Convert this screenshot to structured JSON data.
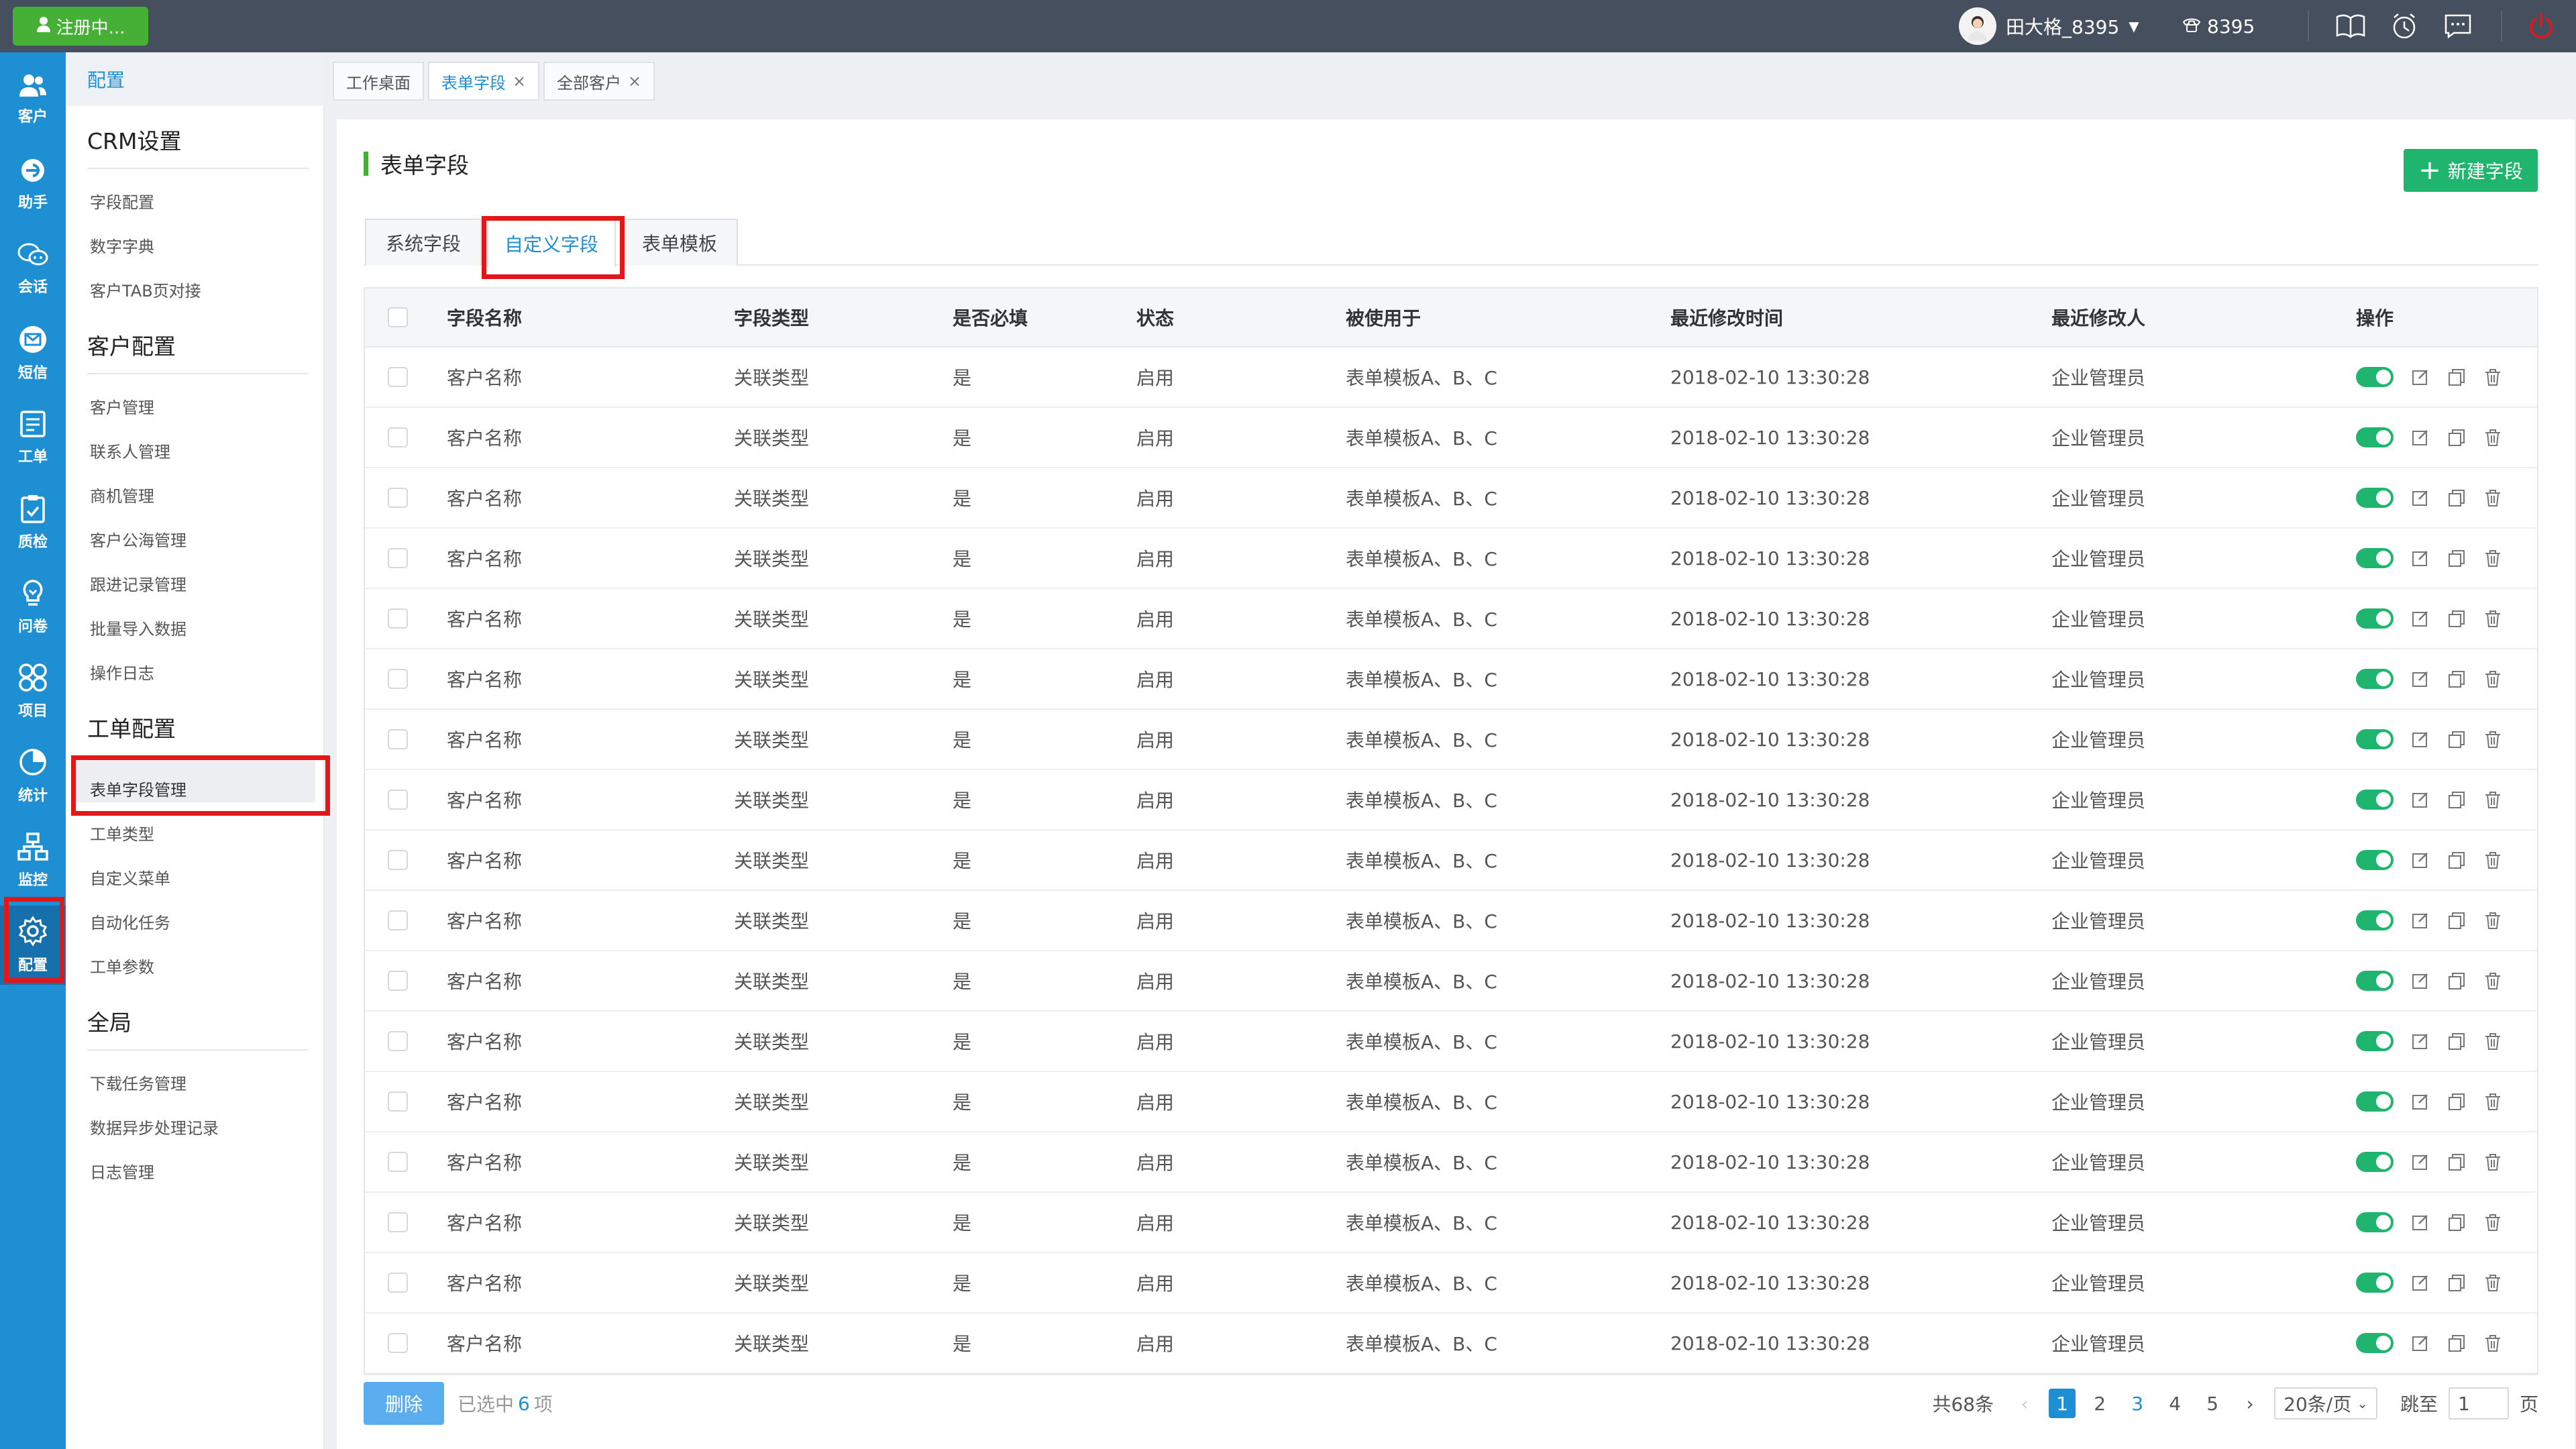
{
  "topbar": {
    "register_label": "注册中...",
    "user_name": "田大格_8395",
    "phone_ext": "8395",
    "icons": [
      "book-icon",
      "clock-icon",
      "message-icon",
      "power-icon"
    ]
  },
  "leftnav": {
    "items": [
      {
        "label": "客户",
        "icon": "user-icon"
      },
      {
        "label": "助手",
        "icon": "assistant-icon"
      },
      {
        "label": "会话",
        "icon": "chat-icon"
      },
      {
        "label": "短信",
        "icon": "mail-icon"
      },
      {
        "label": "工单",
        "icon": "ticket-icon"
      },
      {
        "label": "质检",
        "icon": "clipboard-icon"
      },
      {
        "label": "问卷",
        "icon": "bulb-icon"
      },
      {
        "label": "项目",
        "icon": "grid-icon"
      },
      {
        "label": "统计",
        "icon": "pie-icon"
      },
      {
        "label": "监控",
        "icon": "org-icon"
      },
      {
        "label": "配置",
        "icon": "gear-icon"
      }
    ],
    "active": "配置"
  },
  "subnav": {
    "header": "配置",
    "sections": [
      {
        "title": "CRM设置",
        "items": [
          "字段配置",
          "数字字典",
          "客户TAB页对接"
        ]
      },
      {
        "title": "客户配置",
        "items": [
          "客户管理",
          "联系人管理",
          "商机管理",
          "客户公海管理",
          "跟进记录管理",
          "批量导入数据",
          "操作日志"
        ]
      },
      {
        "title": "工单配置",
        "items": [
          "表单字段管理",
          "工单类型",
          "自定义菜单",
          "自动化任务",
          "工单参数"
        ]
      },
      {
        "title": "全局",
        "items": [
          "下载任务管理",
          "数据异步处理记录",
          "日志管理"
        ]
      }
    ],
    "active_item": "表单字段管理"
  },
  "page_tabs": [
    {
      "label": "工作桌面",
      "closable": false
    },
    {
      "label": "表单字段",
      "closable": true,
      "active": true
    },
    {
      "label": "全部客户",
      "closable": true
    }
  ],
  "main": {
    "title": "表单字段",
    "new_button": "新建字段",
    "field_tabs": [
      "系统字段",
      "自定义字段",
      "表单模板"
    ],
    "active_field_tab": "自定义字段",
    "table": {
      "columns": [
        "字段名称",
        "字段类型",
        "是否必填",
        "状态",
        "被使用于",
        "最近修改时间",
        "最近修改人",
        "操作"
      ],
      "rows": [
        [
          "客户名称",
          "关联类型",
          "是",
          "启用",
          "表单模板A、B、C",
          "2018-02-10 13:30:28",
          "企业管理员"
        ],
        [
          "客户名称",
          "关联类型",
          "是",
          "启用",
          "表单模板A、B、C",
          "2018-02-10 13:30:28",
          "企业管理员"
        ],
        [
          "客户名称",
          "关联类型",
          "是",
          "启用",
          "表单模板A、B、C",
          "2018-02-10 13:30:28",
          "企业管理员"
        ],
        [
          "客户名称",
          "关联类型",
          "是",
          "启用",
          "表单模板A、B、C",
          "2018-02-10 13:30:28",
          "企业管理员"
        ],
        [
          "客户名称",
          "关联类型",
          "是",
          "启用",
          "表单模板A、B、C",
          "2018-02-10 13:30:28",
          "企业管理员"
        ],
        [
          "客户名称",
          "关联类型",
          "是",
          "启用",
          "表单模板A、B、C",
          "2018-02-10 13:30:28",
          "企业管理员"
        ],
        [
          "客户名称",
          "关联类型",
          "是",
          "启用",
          "表单模板A、B、C",
          "2018-02-10 13:30:28",
          "企业管理员"
        ],
        [
          "客户名称",
          "关联类型",
          "是",
          "启用",
          "表单模板A、B、C",
          "2018-02-10 13:30:28",
          "企业管理员"
        ],
        [
          "客户名称",
          "关联类型",
          "是",
          "启用",
          "表单模板A、B、C",
          "2018-02-10 13:30:28",
          "企业管理员"
        ],
        [
          "客户名称",
          "关联类型",
          "是",
          "启用",
          "表单模板A、B、C",
          "2018-02-10 13:30:28",
          "企业管理员"
        ],
        [
          "客户名称",
          "关联类型",
          "是",
          "启用",
          "表单模板A、B、C",
          "2018-02-10 13:30:28",
          "企业管理员"
        ],
        [
          "客户名称",
          "关联类型",
          "是",
          "启用",
          "表单模板A、B、C",
          "2018-02-10 13:30:28",
          "企业管理员"
        ],
        [
          "客户名称",
          "关联类型",
          "是",
          "启用",
          "表单模板A、B、C",
          "2018-02-10 13:30:28",
          "企业管理员"
        ],
        [
          "客户名称",
          "关联类型",
          "是",
          "启用",
          "表单模板A、B、C",
          "2018-02-10 13:30:28",
          "企业管理员"
        ],
        [
          "客户名称",
          "关联类型",
          "是",
          "启用",
          "表单模板A、B、C",
          "2018-02-10 13:30:28",
          "企业管理员"
        ],
        [
          "客户名称",
          "关联类型",
          "是",
          "启用",
          "表单模板A、B、C",
          "2018-02-10 13:30:28",
          "企业管理员"
        ],
        [
          "客户名称",
          "关联类型",
          "是",
          "启用",
          "表单模板A、B、C",
          "2018-02-10 13:30:28",
          "企业管理员"
        ]
      ]
    },
    "footer": {
      "delete_label": "删除",
      "selected_prefix": "已选中",
      "selected_count": "6",
      "selected_suffix": "项",
      "total_label": "共68条",
      "pages": [
        "1",
        "2",
        "3",
        "4",
        "5"
      ],
      "current_page": "1",
      "page_size": "20条/页",
      "jump_label": "跳至",
      "jump_value": "1",
      "page_unit": "页"
    }
  },
  "colors": {
    "nav_blue": "#1e8fd3",
    "topbar": "#464f5d",
    "green": "#1fb56e",
    "highlight_red": "#e3161a"
  }
}
